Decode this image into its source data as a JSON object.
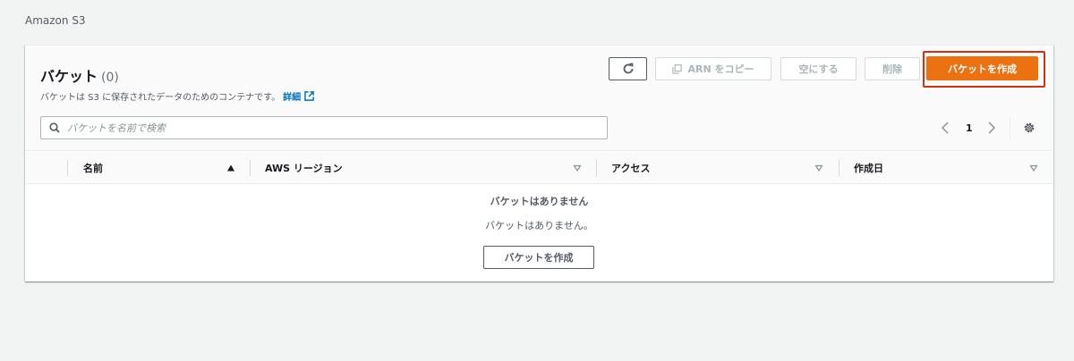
{
  "breadcrumb": "Amazon S3",
  "panel": {
    "title": "バケット",
    "count": "(0)",
    "description": "バケットは S3 に保存されたデータのためのコンテナです。",
    "info_link": "詳細"
  },
  "toolbar": {
    "copy_arn_label": "ARN をコピー",
    "empty_label": "空にする",
    "delete_label": "削除",
    "create_label": "バケットを作成"
  },
  "search": {
    "placeholder": "バケットを名前で検索",
    "value": ""
  },
  "pagination": {
    "current_page": "1"
  },
  "table": {
    "columns": [
      "名前",
      "AWS リージョン",
      "アクセス",
      "作成日"
    ],
    "rows": []
  },
  "empty_state": {
    "title": "バケットはありません",
    "message": "バケットはありません。",
    "button_label": "バケットを作成"
  },
  "colors": {
    "primary_button": "#ec7211",
    "highlight": "#d13212",
    "link": "#0073bb"
  }
}
